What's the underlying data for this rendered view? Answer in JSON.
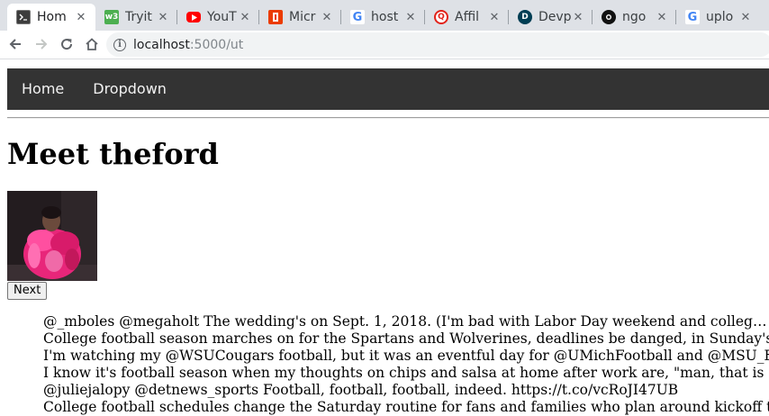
{
  "browser": {
    "tabs": [
      {
        "title": "Hom",
        "icon": "terminal-favicon-icon",
        "active": true
      },
      {
        "title": "Tryit",
        "icon": "w3schools-favicon-icon"
      },
      {
        "title": "YouT",
        "icon": "youtube-favicon-icon"
      },
      {
        "title": "Micr",
        "icon": "office-favicon-icon"
      },
      {
        "title": "host",
        "icon": "google-favicon-icon"
      },
      {
        "title": "Affil",
        "icon": "affiliate-favicon-icon"
      },
      {
        "title": "Devp",
        "icon": "devpost-favicon-icon"
      },
      {
        "title": "ngo",
        "icon": "github-favicon-icon"
      },
      {
        "title": "uplo",
        "icon": "google-favicon-icon"
      }
    ],
    "close_glyph": "✕",
    "address": {
      "host": "localhost",
      "rest": ":5000/ut"
    }
  },
  "navbar": {
    "home_label": "Home",
    "dropdown_label": "Dropdown"
  },
  "profile": {
    "heading": "Meet theford",
    "next_label": "Next"
  },
  "tweets": [
    "@_mboles @megaholt The wedding's on Sept. 1, 2018. (I'm bad with Labor Day weekend and college football.) But you know it'll be a party.",
    "College football season marches on for the Spartans and Wolverines, deadlines be danged, in Sunday's @freepsports .… https",
    "I'm watching my @WSUCougars football, but it was an eventful day for @UMichFootball and @MSU_Football, from Sunda",
    "I know it's football season when my thoughts on chips and salsa at home after work are, \"man, that is a labor-intensive meal.\"",
    "@juliejalopy @detnews_sports Football, football, football, indeed. https://t.co/vcRoJI47UB",
    "College football schedules change the Saturday routine for fans and families who plan around kickoff times every weekend"
  ],
  "colors": {
    "navbar_bg": "#333333",
    "navbar_text": "#f2f2f2",
    "tabstrip_bg": "#dee1e6",
    "photo_accent": "#e8267a"
  }
}
